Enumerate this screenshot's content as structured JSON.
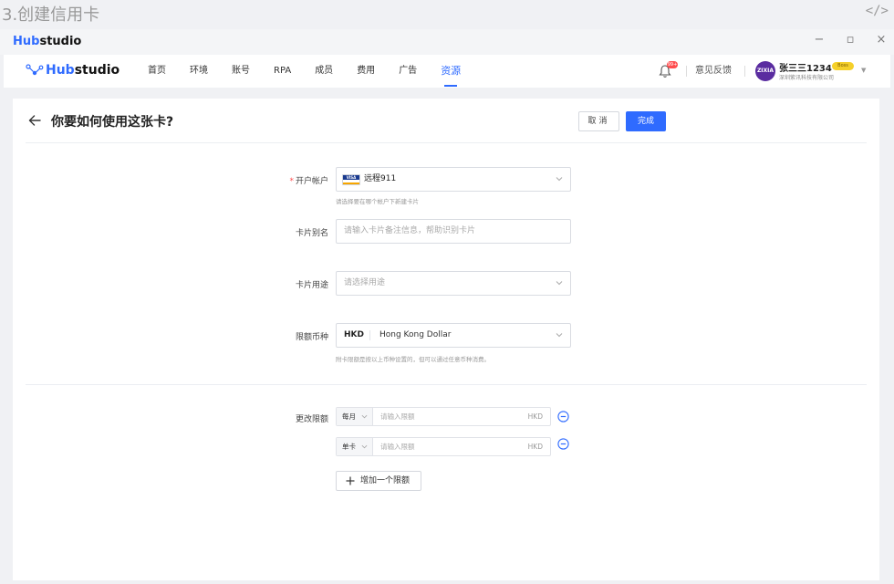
{
  "caption": {
    "title": "3.创建信用卡",
    "code_icon": "</>"
  },
  "titlebar": {
    "app_name_prefix": "Hub",
    "app_name_suffix": "studio",
    "minimize": "−",
    "restore": "▫",
    "close": "×"
  },
  "navbar": {
    "brand_prefix": "Hub",
    "brand_suffix": "studio",
    "items": [
      {
        "label": "首页"
      },
      {
        "label": "环境"
      },
      {
        "label": "账号"
      },
      {
        "label": "RPA"
      },
      {
        "label": "成员"
      },
      {
        "label": "费用"
      },
      {
        "label": "广告"
      },
      {
        "label": "资源"
      }
    ],
    "active_item": "资源",
    "notification_count": "99+",
    "feedback": "意见反馈",
    "user": {
      "avatar_text": "ZIXIA",
      "name": "张三三1234",
      "badge": "Boss",
      "company": "深圳紫讯科技有限公司"
    }
  },
  "page": {
    "title": "你要如何使用这张卡?",
    "cancel_label": "取消",
    "done_label": "完成"
  },
  "form": {
    "account": {
      "label": "开户帐户",
      "required_mark": "*",
      "value": "远程911",
      "card_brand": "VISA",
      "hint": "请选择要在哪个帐户下新建卡片"
    },
    "alias": {
      "label": "卡片别名",
      "placeholder": "请输入卡片备注信息，帮助识别卡片"
    },
    "usage": {
      "label": "卡片用途",
      "placeholder": "请选择用途"
    },
    "currency": {
      "label": "限额币种",
      "code": "HKD",
      "name": "Hong Kong Dollar",
      "hint": "附卡限额是按以上币种设置的，但可以通过任意币种消费。"
    },
    "limits": {
      "label": "更改限额",
      "rows": [
        {
          "period": "每月",
          "placeholder": "请输入限额",
          "unit": "HKD"
        },
        {
          "period": "单卡",
          "placeholder": "请输入限额",
          "unit": "HKD"
        }
      ],
      "add_label": "增加一个限额"
    }
  },
  "colors": {
    "accent": "#2f6bff",
    "required": "#ff4d4f",
    "badge": "#f5d02a",
    "avatar": "#5a2ca0"
  }
}
